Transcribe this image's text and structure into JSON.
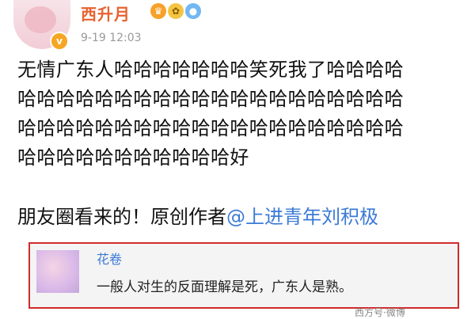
{
  "post": {
    "username": "西升月",
    "badges": [
      "crown-badge",
      "flower-badge",
      "balloon-badge"
    ],
    "verified_icon": "verified-v-icon",
    "time": "9-19 12:03",
    "content_lines": [
      "无情广东人哈哈哈哈哈哈哈笑死我了哈哈哈哈",
      "哈哈哈哈哈哈哈哈哈哈哈哈哈哈哈哈哈哈哈哈",
      "哈哈哈哈哈哈哈哈哈哈哈哈哈哈哈哈哈哈哈哈",
      "哈哈哈哈哈哈哈哈哈哈哈好"
    ],
    "credit_prefix": "朋友圈看来的！原创作者",
    "credit_mention": "@上进青年刘积极"
  },
  "comment": {
    "username": "花卷",
    "text": "一般人对生的反面理解是死，广东人是熟。"
  },
  "watermark": "西方号·微博"
}
